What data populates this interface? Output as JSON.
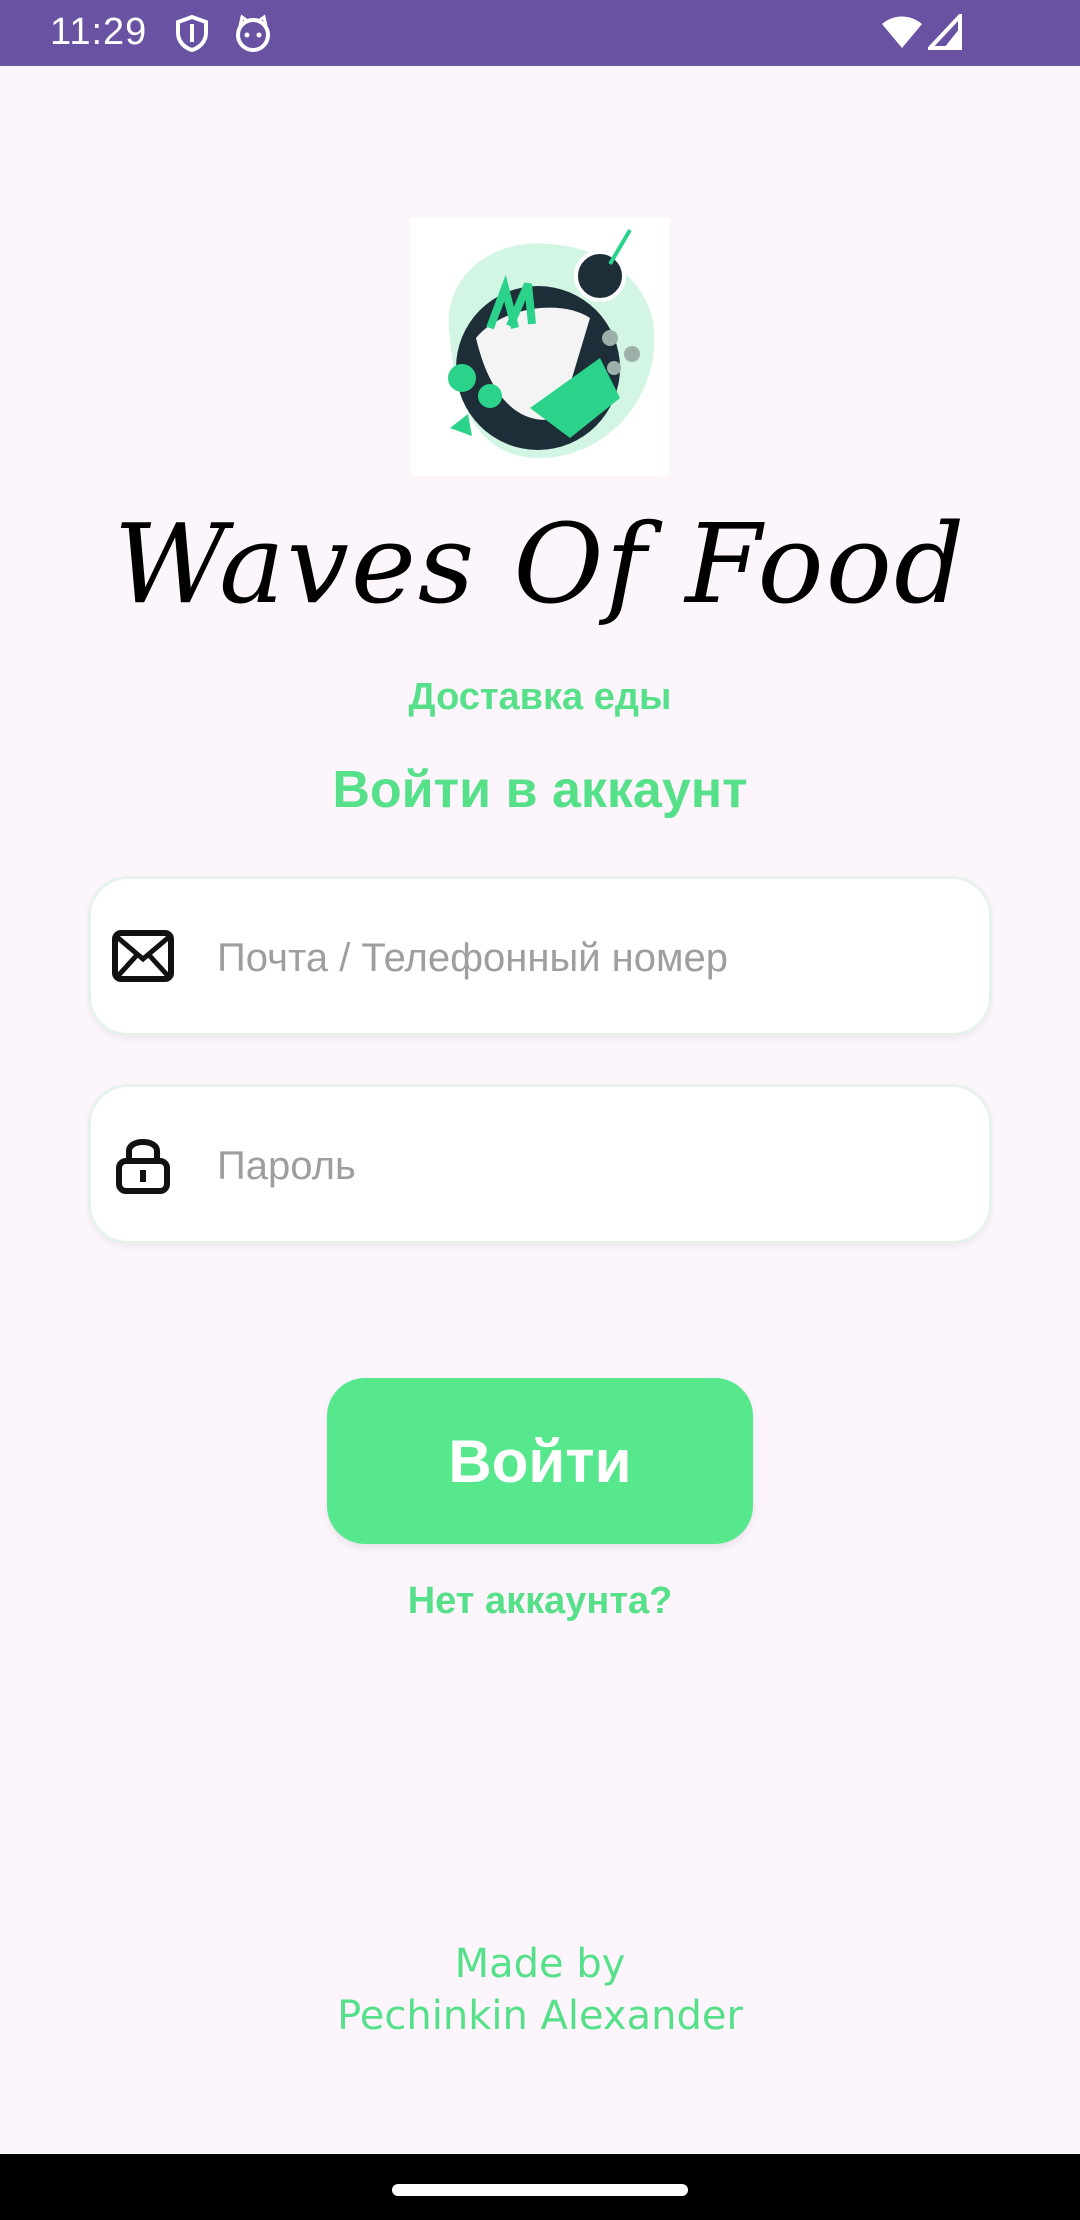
{
  "status_bar": {
    "time": "11:29",
    "icons": [
      "shield-icon",
      "cat-face-icon",
      "wifi-icon",
      "signal-icon"
    ]
  },
  "app": {
    "logo_icon": "food-wrap-plate-logo",
    "title": "Waves Of Food",
    "tagline": "Доставка еды"
  },
  "login": {
    "heading": "Войти в аккаунт",
    "email_placeholder": "Почта / Телефонный номер",
    "email_value": "",
    "email_icon": "envelope-icon",
    "password_placeholder": "Пароль",
    "password_value": "",
    "password_icon": "lock-icon",
    "submit_label": "Войти",
    "signup_link": "Нет аккаунта?"
  },
  "footer": {
    "line1": "Made by",
    "line2": "Pechinkin Alexander"
  },
  "colors": {
    "accent": "#57e88d",
    "status_bar": "#6a52a3",
    "background": "#fdf5fc"
  }
}
